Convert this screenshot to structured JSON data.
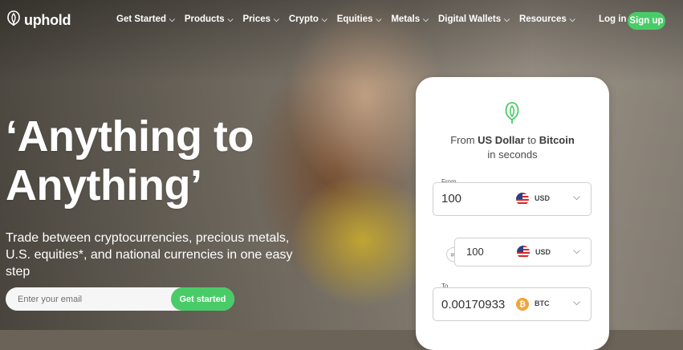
{
  "brand": {
    "name": "uphold"
  },
  "nav": {
    "items": [
      {
        "label": "Get Started"
      },
      {
        "label": "Products"
      },
      {
        "label": "Prices"
      },
      {
        "label": "Crypto"
      },
      {
        "label": "Equities"
      },
      {
        "label": "Metals"
      },
      {
        "label": "Digital Wallets"
      },
      {
        "label": "Resources"
      }
    ],
    "login": "Log in",
    "signup": "Sign up"
  },
  "hero": {
    "headline_line1": "‘Anything to",
    "headline_line2": "Anything’",
    "subtext": "Trade between cryptocurrencies, precious metals, U.S. equities*, and national currencies in one easy step",
    "email_placeholder": "Enter your email",
    "cta": "Get started"
  },
  "widget": {
    "title_prefix": "From ",
    "from_name": "US Dollar",
    "title_mid": " to ",
    "to_name": "Bitcoin",
    "title_suffix": "in seconds",
    "from_label": "From",
    "from_amount": "100",
    "from_currency": "USD",
    "mid_amount": "100",
    "mid_currency": "USD",
    "to_label": "To",
    "to_amount": "0.00170933",
    "to_currency": "BTC"
  },
  "colors": {
    "accent": "#49cc68",
    "btc": "#f2a33a"
  },
  "icons": {
    "logo": "uphold-logo-icon",
    "chevron": "chevron-down-icon",
    "swap": "swap-icon",
    "flag": "us-flag-icon",
    "bitcoin": "bitcoin-icon"
  }
}
